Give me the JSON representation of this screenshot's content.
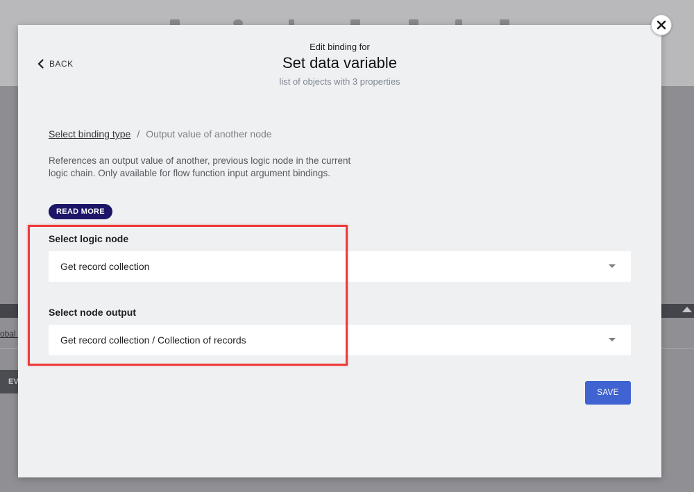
{
  "background": {
    "link_text": "obal c",
    "button_label": "EV"
  },
  "modal": {
    "back_label": "BACK",
    "pre_title": "Edit binding for",
    "title": "Set data variable",
    "subtitle": "list of objects with 3 properties",
    "breadcrumb": {
      "link": "Select binding type",
      "separator": "/",
      "current": "Output value of another node"
    },
    "description": "References an output value of another, previous logic node in the current logic chain. Only available for flow function input argument bindings.",
    "read_more_label": "READ MORE",
    "fields": {
      "logic_node": {
        "label": "Select logic node",
        "value": "Get record collection"
      },
      "node_output": {
        "label": "Select node output",
        "value": "Get record collection / Collection of records"
      }
    },
    "save_label": "SAVE"
  },
  "colors": {
    "accent": "#3f63d0",
    "badge": "#1d1668",
    "highlight": "#ec3a3a",
    "modal_bg": "#eff0f2"
  },
  "icons": [
    "close-icon",
    "chevron-left-icon",
    "caret-down-icon"
  ]
}
